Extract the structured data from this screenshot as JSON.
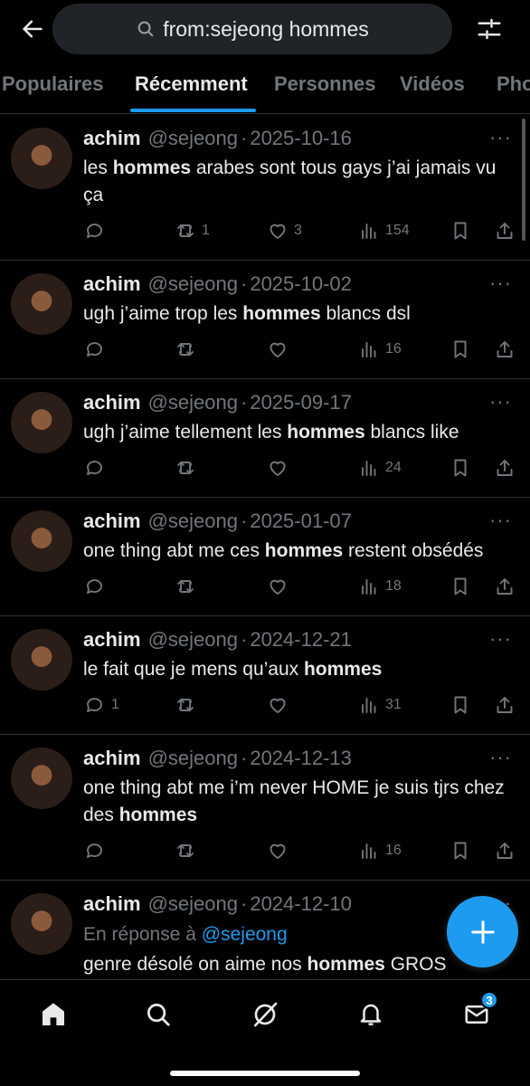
{
  "search": {
    "query": "from:sejeong hommes"
  },
  "tabs": [
    {
      "label": "Populaires"
    },
    {
      "label": "Récemment"
    },
    {
      "label": "Personnes"
    },
    {
      "label": "Vidéos"
    },
    {
      "label": "Pho"
    }
  ],
  "tweets": [
    {
      "name": "achim",
      "handle": "@sejeong",
      "date": "2025-10-16",
      "parts": [
        {
          "t": "les "
        },
        {
          "t": "hommes",
          "b": true
        },
        {
          "t": " arabes sont tous gays j’ai jamais vu ça"
        }
      ],
      "replies": "",
      "retweets": "1",
      "likes": "3",
      "views": "154"
    },
    {
      "name": "achim",
      "handle": "@sejeong",
      "date": "2025-10-02",
      "parts": [
        {
          "t": "ugh j’aime trop les "
        },
        {
          "t": "hommes",
          "b": true
        },
        {
          "t": " blancs dsl"
        }
      ],
      "replies": "",
      "retweets": "",
      "likes": "",
      "views": "16"
    },
    {
      "name": "achim",
      "handle": "@sejeong",
      "date": "2025-09-17",
      "parts": [
        {
          "t": "ugh j’aime tellement les "
        },
        {
          "t": "hommes",
          "b": true
        },
        {
          "t": " blancs like"
        }
      ],
      "replies": "",
      "retweets": "",
      "likes": "",
      "views": "24"
    },
    {
      "name": "achim",
      "handle": "@sejeong",
      "date": "2025-01-07",
      "parts": [
        {
          "t": "one thing abt me ces "
        },
        {
          "t": "hommes",
          "b": true
        },
        {
          "t": " restent obsédés"
        }
      ],
      "replies": "",
      "retweets": "",
      "likes": "",
      "views": "18"
    },
    {
      "name": "achim",
      "handle": "@sejeong",
      "date": "2024-12-21",
      "parts": [
        {
          "t": "le fait que je mens qu’aux "
        },
        {
          "t": "hommes",
          "b": true
        }
      ],
      "replies": "1",
      "retweets": "",
      "likes": "",
      "views": "31"
    },
    {
      "name": "achim",
      "handle": "@sejeong",
      "date": "2024-12-13",
      "parts": [
        {
          "t": "one thing abt me i’m never HOME je suis tjrs chez des "
        },
        {
          "t": "hommes",
          "b": true
        }
      ],
      "replies": "",
      "retweets": "",
      "likes": "",
      "views": "16"
    },
    {
      "name": "achim",
      "handle": "@sejeong",
      "date": "2024-12-10",
      "reply_prefix": "En réponse à",
      "reply_mention": "@sejeong",
      "parts": [
        {
          "t": "genre désolé on aime nos "
        },
        {
          "t": "hommes",
          "b": true
        },
        {
          "t": " GROS ASEFFF!!!! 😣 😣 😣"
        }
      ],
      "replies": "",
      "retweets": "",
      "likes": "",
      "views": ""
    }
  ],
  "more_label": "···",
  "bottom_nav": {
    "messages_badge": "3"
  },
  "icons": [
    "back-arrow-icon",
    "search-icon",
    "sliders-icon",
    "reply-icon",
    "retweet-icon",
    "like-icon",
    "views-icon",
    "bookmark-icon",
    "share-icon",
    "home-icon",
    "explore-icon",
    "grok-icon",
    "bell-icon",
    "mail-icon",
    "plus-icon"
  ],
  "colors": {
    "accent": "#1d9bf0",
    "muted": "#71767b",
    "text": "#e7e9ea",
    "bg": "#000000"
  }
}
